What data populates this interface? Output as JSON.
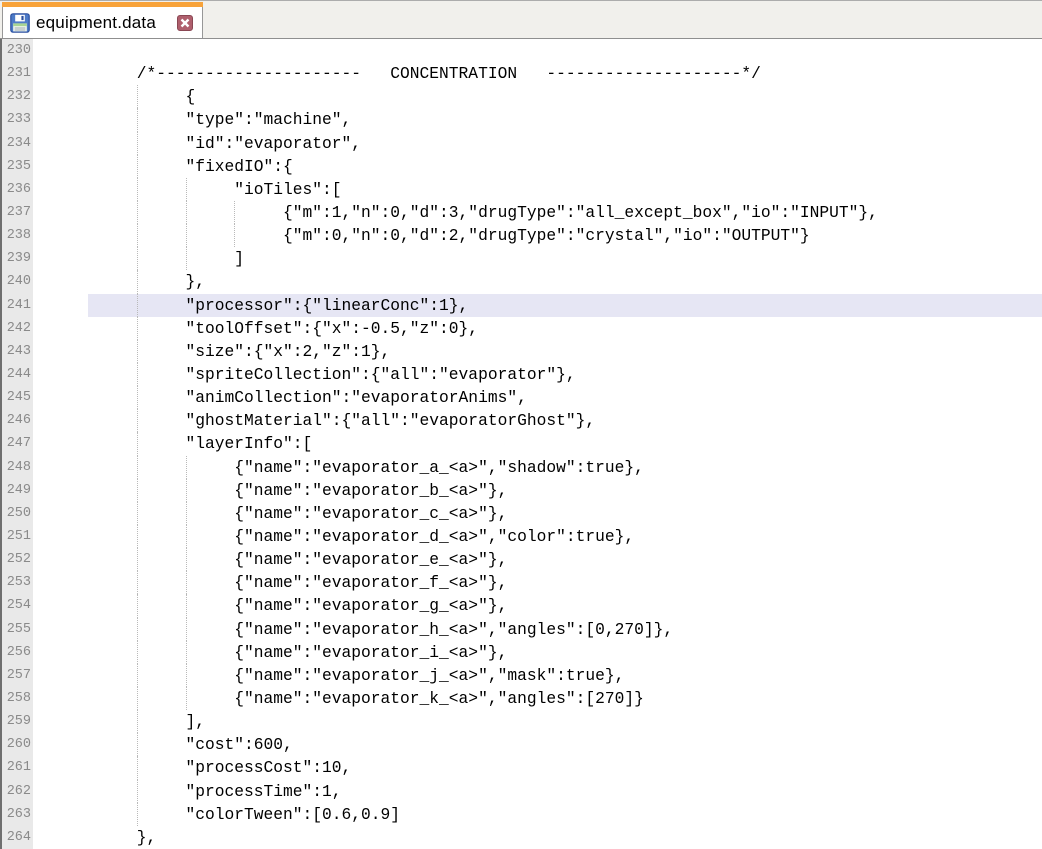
{
  "tab_bar": {
    "background": "#F1F0EC",
    "tab": {
      "title": "equipment.data",
      "icon": "floppy-save-icon",
      "close_icon": "close-x-icon",
      "active_stripe_color": "#F8A33A",
      "close_button_color": "#AF5F6D",
      "background": "#FFFFFF"
    }
  },
  "editor": {
    "language": "plain-text",
    "current_line": 241,
    "first_line_number": 230,
    "last_line_number": 264,
    "colors": {
      "text": "#000000",
      "background": "#FFFFFF",
      "gutter_background": "#E9E9E9",
      "gutter_text": "#8A8A8A",
      "current_line_background": "#E6E6F4",
      "indent_guide": "#B9B9B9"
    },
    "lines": [
      {
        "n": 230,
        "t": "",
        "g": []
      },
      {
        "n": 231,
        "t": "     /*---------------------   CONCENTRATION   --------------------*/",
        "g": []
      },
      {
        "n": 232,
        "t": "          {",
        "g": [
          1
        ]
      },
      {
        "n": 233,
        "t": "          \"type\":\"machine\",",
        "g": [
          1
        ]
      },
      {
        "n": 234,
        "t": "          \"id\":\"evaporator\",",
        "g": [
          1
        ]
      },
      {
        "n": 235,
        "t": "          \"fixedIO\":{",
        "g": [
          1
        ]
      },
      {
        "n": 236,
        "t": "               \"ioTiles\":[",
        "g": [
          1,
          2
        ]
      },
      {
        "n": 237,
        "t": "                    {\"m\":1,\"n\":0,\"d\":3,\"drugType\":\"all_except_box\",\"io\":\"INPUT\"},",
        "g": [
          1,
          2,
          3
        ]
      },
      {
        "n": 238,
        "t": "                    {\"m\":0,\"n\":0,\"d\":2,\"drugType\":\"crystal\",\"io\":\"OUTPUT\"}",
        "g": [
          1,
          2,
          3
        ]
      },
      {
        "n": 239,
        "t": "               ]",
        "g": [
          1,
          2
        ]
      },
      {
        "n": 240,
        "t": "          },",
        "g": [
          1
        ]
      },
      {
        "n": 241,
        "t": "          \"processor\":{\"linearConc\":1},",
        "g": [
          1
        ],
        "hl": true
      },
      {
        "n": 242,
        "t": "          \"toolOffset\":{\"x\":-0.5,\"z\":0},",
        "g": [
          1
        ]
      },
      {
        "n": 243,
        "t": "          \"size\":{\"x\":2,\"z\":1},",
        "g": [
          1
        ]
      },
      {
        "n": 244,
        "t": "          \"spriteCollection\":{\"all\":\"evaporator\"},",
        "g": [
          1
        ]
      },
      {
        "n": 245,
        "t": "          \"animCollection\":\"evaporatorAnims\",",
        "g": [
          1
        ]
      },
      {
        "n": 246,
        "t": "          \"ghostMaterial\":{\"all\":\"evaporatorGhost\"},",
        "g": [
          1
        ]
      },
      {
        "n": 247,
        "t": "          \"layerInfo\":[",
        "g": [
          1
        ]
      },
      {
        "n": 248,
        "t": "               {\"name\":\"evaporator_a_<a>\",\"shadow\":true},",
        "g": [
          1,
          2
        ]
      },
      {
        "n": 249,
        "t": "               {\"name\":\"evaporator_b_<a>\"},",
        "g": [
          1,
          2
        ]
      },
      {
        "n": 250,
        "t": "               {\"name\":\"evaporator_c_<a>\"},",
        "g": [
          1,
          2
        ]
      },
      {
        "n": 251,
        "t": "               {\"name\":\"evaporator_d_<a>\",\"color\":true},",
        "g": [
          1,
          2
        ]
      },
      {
        "n": 252,
        "t": "               {\"name\":\"evaporator_e_<a>\"},",
        "g": [
          1,
          2
        ]
      },
      {
        "n": 253,
        "t": "               {\"name\":\"evaporator_f_<a>\"},",
        "g": [
          1,
          2
        ]
      },
      {
        "n": 254,
        "t": "               {\"name\":\"evaporator_g_<a>\"},",
        "g": [
          1,
          2
        ]
      },
      {
        "n": 255,
        "t": "               {\"name\":\"evaporator_h_<a>\",\"angles\":[0,270]},",
        "g": [
          1,
          2
        ]
      },
      {
        "n": 256,
        "t": "               {\"name\":\"evaporator_i_<a>\"},",
        "g": [
          1,
          2
        ]
      },
      {
        "n": 257,
        "t": "               {\"name\":\"evaporator_j_<a>\",\"mask\":true},",
        "g": [
          1,
          2
        ]
      },
      {
        "n": 258,
        "t": "               {\"name\":\"evaporator_k_<a>\",\"angles\":[270]}",
        "g": [
          1,
          2
        ]
      },
      {
        "n": 259,
        "t": "          ],",
        "g": [
          1
        ]
      },
      {
        "n": 260,
        "t": "          \"cost\":600,",
        "g": [
          1
        ]
      },
      {
        "n": 261,
        "t": "          \"processCost\":10,",
        "g": [
          1
        ]
      },
      {
        "n": 262,
        "t": "          \"processTime\":1,",
        "g": [
          1
        ]
      },
      {
        "n": 263,
        "t": "          \"colorTween\":[0.6,0.9]",
        "g": [
          1
        ]
      },
      {
        "n": 264,
        "t": "     },",
        "g": []
      }
    ]
  }
}
